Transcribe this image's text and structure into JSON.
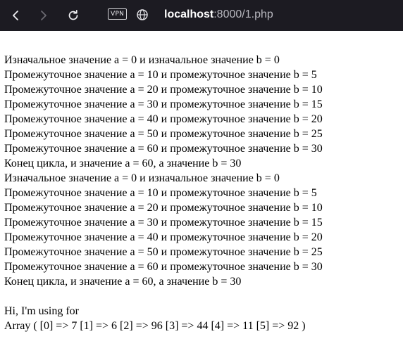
{
  "browser": {
    "url_host": "localhost",
    "url_path": ":8000/1.php",
    "vpn_label": "VPN",
    "icons": [
      "back-icon",
      "forward-icon",
      "reload-icon",
      "globe-icon"
    ]
  },
  "output": {
    "block1": [
      "Изначальное значение a = 0 и изначальное значение b = 0",
      "Промежуточное значение a = 10 и промежуточное значение b = 5",
      "Промежуточное значение a = 20 и промежуточное значение b = 10",
      "Промежуточное значение a = 30 и промежуточное значение b = 15",
      "Промежуточное значение a = 40 и промежуточное значение b = 20",
      "Промежуточное значение a = 50 и промежуточное значение b = 25",
      "Промежуточное значение a = 60 и промежуточное значение b = 30",
      "Конец цикла, и значение a = 60, а значение b = 30"
    ],
    "block2": [
      "Изначальное значение a = 0 и изначальное значение b = 0",
      "Промежуточное значение a = 10 и промежуточное значение b = 5",
      "Промежуточное значение a = 20 и промежуточное значение b = 10",
      "Промежуточное значение a = 30 и промежуточное значение b = 15",
      "Промежуточное значение a = 40 и промежуточное значение b = 20",
      "Промежуточное значение a = 50 и промежуточное значение b = 25",
      "Промежуточное значение a = 60 и промежуточное значение b = 30",
      "Конец цикла, и значение a = 60, а значение b = 30"
    ],
    "greeting": "Hi, I'm using for",
    "array_dump": "Array ( [0] => 7 [1] => 6 [2] => 96 [3] => 44 [4] => 11 [5] => 92 )"
  }
}
